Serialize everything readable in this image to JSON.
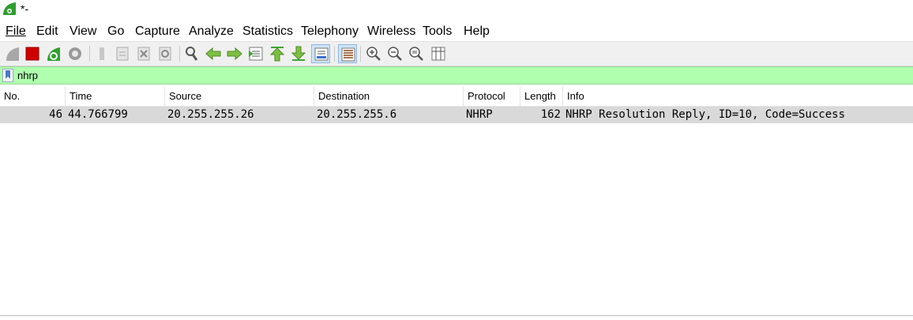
{
  "window": {
    "title": "*-"
  },
  "menu": [
    "File",
    "Edit",
    "View",
    "Go",
    "Capture",
    "Analyze",
    "Statistics",
    "Telephony",
    "Wireless",
    "Tools",
    "Help"
  ],
  "toolbar": {
    "icons": [
      "start-capture-icon",
      "stop-capture-icon",
      "restart-capture-icon",
      "capture-options-icon",
      "open-file-icon",
      "save-file-icon",
      "close-file-icon",
      "reload-file-icon",
      "find-packet-icon",
      "go-back-icon",
      "go-forward-icon",
      "go-to-packet-icon",
      "go-first-packet-icon",
      "go-last-packet-icon",
      "auto-scroll-icon",
      "colorize-icon",
      "zoom-in-icon",
      "zoom-out-icon",
      "normal-size-icon",
      "resize-columns-icon"
    ]
  },
  "filter": {
    "value": "nhrp"
  },
  "columns": [
    "No.",
    "Time",
    "Source",
    "Destination",
    "Protocol",
    "Length",
    "Info"
  ],
  "packets": [
    {
      "no": "46",
      "time": "44.766799",
      "source": "20.255.255.26",
      "destination": "20.255.255.6",
      "protocol": "NHRP",
      "length": "162",
      "info": "NHRP Resolution Reply, ID=10, Code=Success"
    }
  ],
  "colors": {
    "filter_valid": "#afffaf",
    "selected_row": "#d9d9d9"
  }
}
